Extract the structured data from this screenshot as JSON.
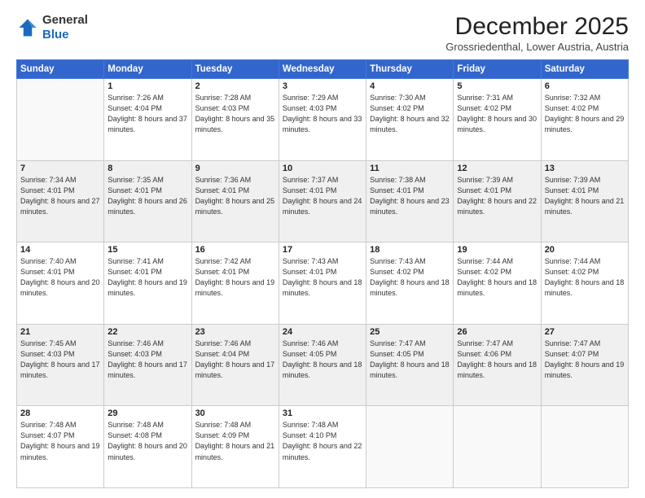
{
  "logo": {
    "general": "General",
    "blue": "Blue"
  },
  "header": {
    "month": "December 2025",
    "location": "Grossriedenthal, Lower Austria, Austria"
  },
  "days_of_week": [
    "Sunday",
    "Monday",
    "Tuesday",
    "Wednesday",
    "Thursday",
    "Friday",
    "Saturday"
  ],
  "weeks": [
    [
      {
        "day": "",
        "sunrise": "",
        "sunset": "",
        "daylight": ""
      },
      {
        "day": "1",
        "sunrise": "Sunrise: 7:26 AM",
        "sunset": "Sunset: 4:04 PM",
        "daylight": "Daylight: 8 hours and 37 minutes."
      },
      {
        "day": "2",
        "sunrise": "Sunrise: 7:28 AM",
        "sunset": "Sunset: 4:03 PM",
        "daylight": "Daylight: 8 hours and 35 minutes."
      },
      {
        "day": "3",
        "sunrise": "Sunrise: 7:29 AM",
        "sunset": "Sunset: 4:03 PM",
        "daylight": "Daylight: 8 hours and 33 minutes."
      },
      {
        "day": "4",
        "sunrise": "Sunrise: 7:30 AM",
        "sunset": "Sunset: 4:02 PM",
        "daylight": "Daylight: 8 hours and 32 minutes."
      },
      {
        "day": "5",
        "sunrise": "Sunrise: 7:31 AM",
        "sunset": "Sunset: 4:02 PM",
        "daylight": "Daylight: 8 hours and 30 minutes."
      },
      {
        "day": "6",
        "sunrise": "Sunrise: 7:32 AM",
        "sunset": "Sunset: 4:02 PM",
        "daylight": "Daylight: 8 hours and 29 minutes."
      }
    ],
    [
      {
        "day": "7",
        "sunrise": "Sunrise: 7:34 AM",
        "sunset": "Sunset: 4:01 PM",
        "daylight": "Daylight: 8 hours and 27 minutes."
      },
      {
        "day": "8",
        "sunrise": "Sunrise: 7:35 AM",
        "sunset": "Sunset: 4:01 PM",
        "daylight": "Daylight: 8 hours and 26 minutes."
      },
      {
        "day": "9",
        "sunrise": "Sunrise: 7:36 AM",
        "sunset": "Sunset: 4:01 PM",
        "daylight": "Daylight: 8 hours and 25 minutes."
      },
      {
        "day": "10",
        "sunrise": "Sunrise: 7:37 AM",
        "sunset": "Sunset: 4:01 PM",
        "daylight": "Daylight: 8 hours and 24 minutes."
      },
      {
        "day": "11",
        "sunrise": "Sunrise: 7:38 AM",
        "sunset": "Sunset: 4:01 PM",
        "daylight": "Daylight: 8 hours and 23 minutes."
      },
      {
        "day": "12",
        "sunrise": "Sunrise: 7:39 AM",
        "sunset": "Sunset: 4:01 PM",
        "daylight": "Daylight: 8 hours and 22 minutes."
      },
      {
        "day": "13",
        "sunrise": "Sunrise: 7:39 AM",
        "sunset": "Sunset: 4:01 PM",
        "daylight": "Daylight: 8 hours and 21 minutes."
      }
    ],
    [
      {
        "day": "14",
        "sunrise": "Sunrise: 7:40 AM",
        "sunset": "Sunset: 4:01 PM",
        "daylight": "Daylight: 8 hours and 20 minutes."
      },
      {
        "day": "15",
        "sunrise": "Sunrise: 7:41 AM",
        "sunset": "Sunset: 4:01 PM",
        "daylight": "Daylight: 8 hours and 19 minutes."
      },
      {
        "day": "16",
        "sunrise": "Sunrise: 7:42 AM",
        "sunset": "Sunset: 4:01 PM",
        "daylight": "Daylight: 8 hours and 19 minutes."
      },
      {
        "day": "17",
        "sunrise": "Sunrise: 7:43 AM",
        "sunset": "Sunset: 4:01 PM",
        "daylight": "Daylight: 8 hours and 18 minutes."
      },
      {
        "day": "18",
        "sunrise": "Sunrise: 7:43 AM",
        "sunset": "Sunset: 4:02 PM",
        "daylight": "Daylight: 8 hours and 18 minutes."
      },
      {
        "day": "19",
        "sunrise": "Sunrise: 7:44 AM",
        "sunset": "Sunset: 4:02 PM",
        "daylight": "Daylight: 8 hours and 18 minutes."
      },
      {
        "day": "20",
        "sunrise": "Sunrise: 7:44 AM",
        "sunset": "Sunset: 4:02 PM",
        "daylight": "Daylight: 8 hours and 18 minutes."
      }
    ],
    [
      {
        "day": "21",
        "sunrise": "Sunrise: 7:45 AM",
        "sunset": "Sunset: 4:03 PM",
        "daylight": "Daylight: 8 hours and 17 minutes."
      },
      {
        "day": "22",
        "sunrise": "Sunrise: 7:46 AM",
        "sunset": "Sunset: 4:03 PM",
        "daylight": "Daylight: 8 hours and 17 minutes."
      },
      {
        "day": "23",
        "sunrise": "Sunrise: 7:46 AM",
        "sunset": "Sunset: 4:04 PM",
        "daylight": "Daylight: 8 hours and 17 minutes."
      },
      {
        "day": "24",
        "sunrise": "Sunrise: 7:46 AM",
        "sunset": "Sunset: 4:05 PM",
        "daylight": "Daylight: 8 hours and 18 minutes."
      },
      {
        "day": "25",
        "sunrise": "Sunrise: 7:47 AM",
        "sunset": "Sunset: 4:05 PM",
        "daylight": "Daylight: 8 hours and 18 minutes."
      },
      {
        "day": "26",
        "sunrise": "Sunrise: 7:47 AM",
        "sunset": "Sunset: 4:06 PM",
        "daylight": "Daylight: 8 hours and 18 minutes."
      },
      {
        "day": "27",
        "sunrise": "Sunrise: 7:47 AM",
        "sunset": "Sunset: 4:07 PM",
        "daylight": "Daylight: 8 hours and 19 minutes."
      }
    ],
    [
      {
        "day": "28",
        "sunrise": "Sunrise: 7:48 AM",
        "sunset": "Sunset: 4:07 PM",
        "daylight": "Daylight: 8 hours and 19 minutes."
      },
      {
        "day": "29",
        "sunrise": "Sunrise: 7:48 AM",
        "sunset": "Sunset: 4:08 PM",
        "daylight": "Daylight: 8 hours and 20 minutes."
      },
      {
        "day": "30",
        "sunrise": "Sunrise: 7:48 AM",
        "sunset": "Sunset: 4:09 PM",
        "daylight": "Daylight: 8 hours and 21 minutes."
      },
      {
        "day": "31",
        "sunrise": "Sunrise: 7:48 AM",
        "sunset": "Sunset: 4:10 PM",
        "daylight": "Daylight: 8 hours and 22 minutes."
      },
      {
        "day": "",
        "sunrise": "",
        "sunset": "",
        "daylight": ""
      },
      {
        "day": "",
        "sunrise": "",
        "sunset": "",
        "daylight": ""
      },
      {
        "day": "",
        "sunrise": "",
        "sunset": "",
        "daylight": ""
      }
    ]
  ]
}
